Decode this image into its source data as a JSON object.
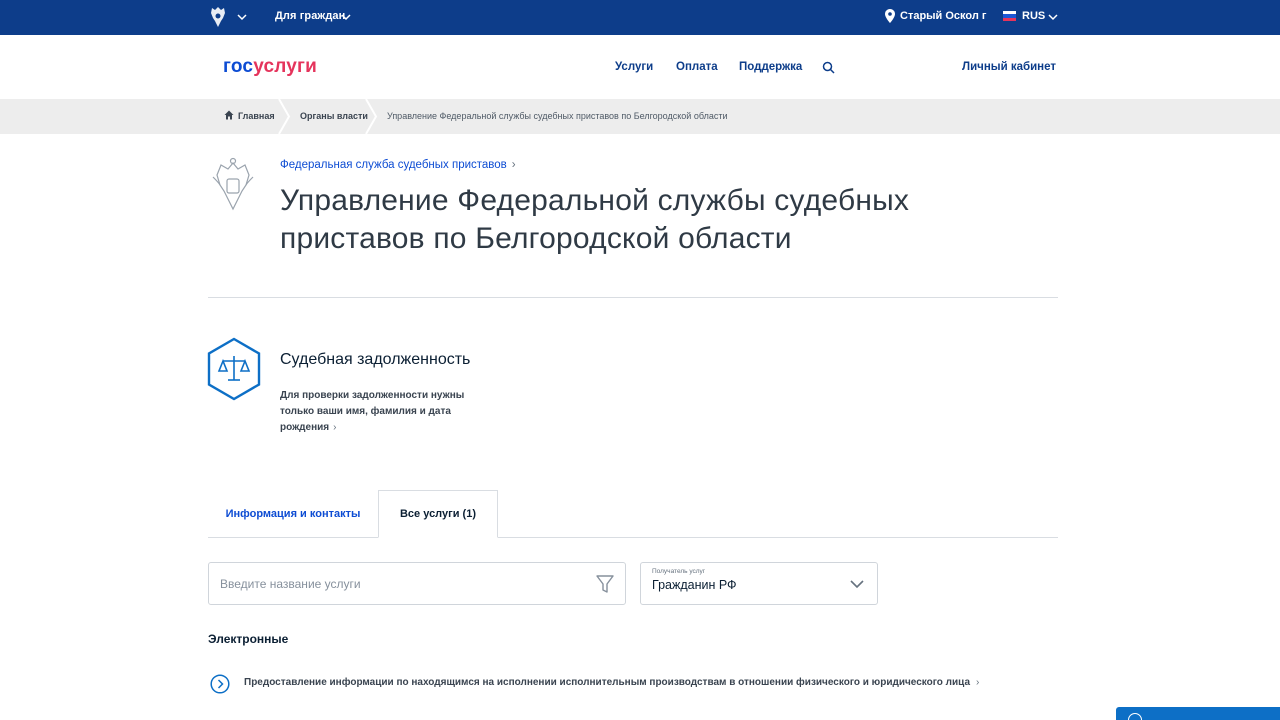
{
  "topbar": {
    "audience_label": "Для граждан",
    "city": "Старый Оскол г",
    "language": "RUS",
    "colors": {
      "background": "#0d3d8a"
    }
  },
  "header": {
    "logo_part1": "гос",
    "logo_part2": "услуги",
    "nav": [
      "Услуги",
      "Оплата",
      "Поддержка"
    ],
    "cabinet_label": "Личный кабинет"
  },
  "breadcrumbs": [
    "Главная",
    "Органы власти",
    "Управление Федеральной службы судебных приставов по Белгородской области"
  ],
  "org": {
    "parent_link": "Федеральная служба судебных приставов",
    "title": "Управление Федеральной службы судебных приставов по Белгородской области"
  },
  "debt": {
    "title": "Судебная задолженность",
    "description": "Для проверки задолженности нужны только ваши имя, фамилия и дата рождения",
    "icon": "scales-icon"
  },
  "tabs": [
    {
      "label": "Информация и контакты",
      "active": false
    },
    {
      "label": "Все услуги (1)",
      "active": true
    }
  ],
  "filters": {
    "search_placeholder": "Введите название услуги",
    "recipient_label": "Получатель услуг",
    "recipient_value": "Гражданин РФ"
  },
  "services": {
    "section_title": "Электронные",
    "items": [
      {
        "label": "Предоставление информации по находящимся на исполнении исполнительным производствам в отношении физического и юридического лица"
      }
    ]
  }
}
